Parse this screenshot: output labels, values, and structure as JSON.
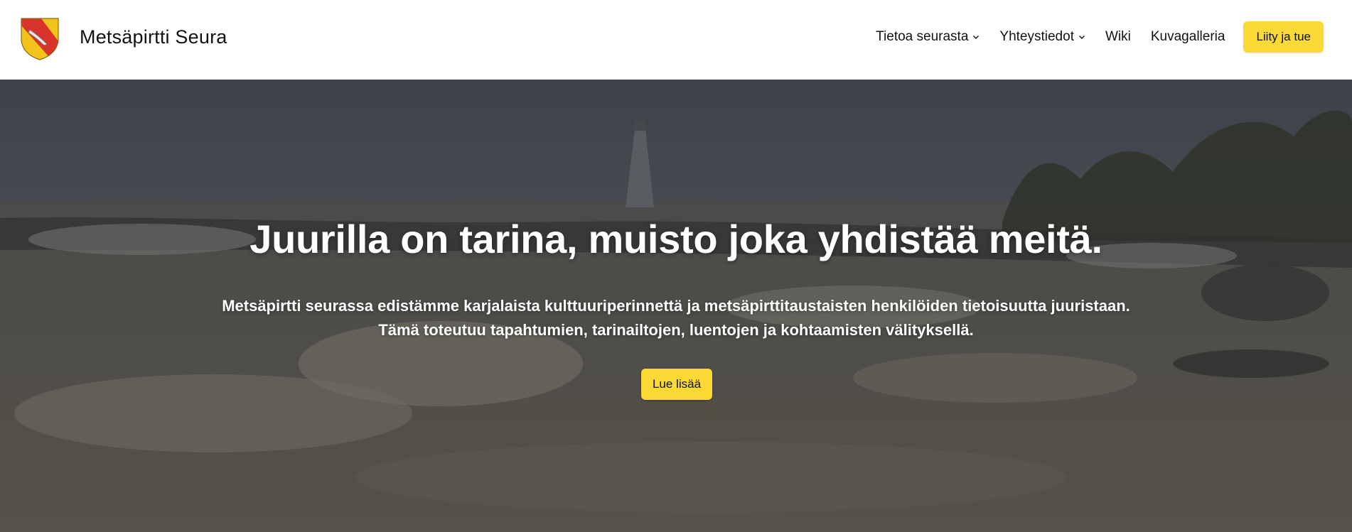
{
  "site": {
    "title": "Metsäpirtti Seura",
    "logo": "coat-of-arms-icon"
  },
  "nav": {
    "items": [
      {
        "label": "Tietoa seurasta",
        "has_dropdown": true
      },
      {
        "label": "Yhteystiedot",
        "has_dropdown": true
      },
      {
        "label": "Wiki",
        "has_dropdown": false
      },
      {
        "label": "Kuvagalleria",
        "has_dropdown": false
      }
    ],
    "cta_label": "Liity ja tue"
  },
  "hero": {
    "title": "Juurilla on tarina, muisto joka yhdistää meitä.",
    "text_line1": "Metsäpirtti seurassa edistämme karjalaista kulttuuriperinnettä ja metsäpirttitaustaisten henkilöiden tietoisuutta juuristaan.",
    "text_line2": "Tämä toteutuu tapahtumien, tarinailtojen, luentojen ja kohtaamisten välityksellä.",
    "button_label": "Lue lisää",
    "background": "stormy-lake-lighthouse-image"
  },
  "colors": {
    "accent": "#fad935",
    "header_bg": "#ffffff",
    "hero_text": "#ffffff"
  }
}
